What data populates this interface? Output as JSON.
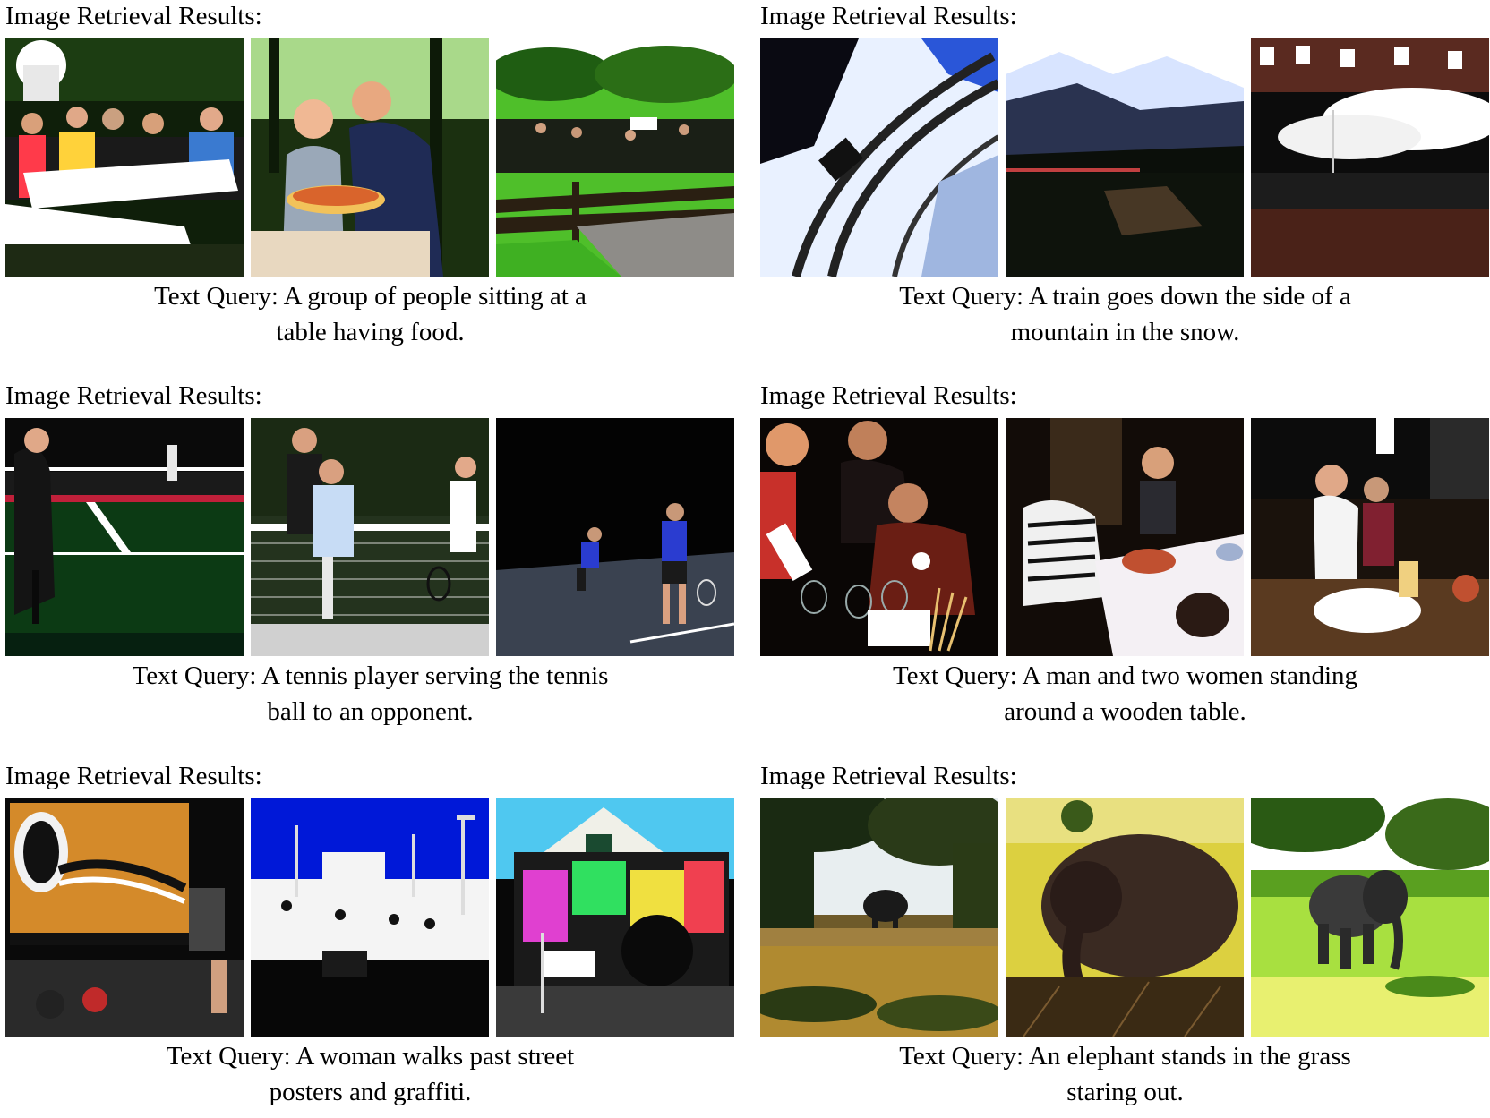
{
  "panels": [
    {
      "header": "Image Retrieval Results:",
      "caption_line1": "Text Query: A group of people sitting at a",
      "caption_line2": "table having food.",
      "images": [
        "picnic-group-photo",
        "couple-with-pizza-photo",
        "park-fence-crowd-photo"
      ]
    },
    {
      "header": "Image Retrieval Results:",
      "caption_line1": "Text Query: A train goes down the side of a",
      "caption_line2": "mountain in the snow.",
      "images": [
        "snowy-railway-curve-photo",
        "snowy-mountain-valley-photo",
        "steam-train-bridge-photo"
      ]
    },
    {
      "header": "Image Retrieval Results:",
      "caption_line1": "Text Query: A tennis player serving the tennis",
      "caption_line2": "ball to an opponent.",
      "images": [
        "tennis-court-player-photo",
        "tennis-net-players-photo",
        "night-tennis-players-photo"
      ]
    },
    {
      "header": "Image Retrieval Results:",
      "caption_line1": "Text Query: A man and two women standing",
      "caption_line2": "around a wooden table.",
      "images": [
        "wine-tasting-people-photo",
        "dinner-table-group-photo",
        "kitchen-cooking-people-photo"
      ]
    },
    {
      "header": "Image Retrieval Results:",
      "caption_line1": "Text Query: A woman walks past street",
      "caption_line2": "posters and graffiti.",
      "images": [
        "graffiti-wall-photo",
        "white-building-street-photo",
        "graffiti-house-photo"
      ]
    },
    {
      "header": "Image Retrieval Results:",
      "caption_line1": "Text Query: An elephant stands in the grass",
      "caption_line2": "staring out.",
      "images": [
        "elephant-savanna-trees-photo",
        "elephant-lying-grass-photo",
        "elephant-green-field-photo"
      ]
    }
  ]
}
